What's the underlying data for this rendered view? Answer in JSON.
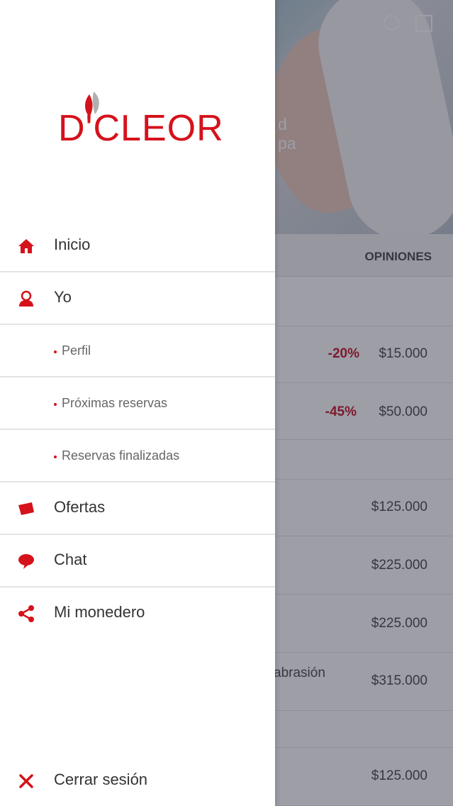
{
  "brand": {
    "logo_text": "D'CLEOR",
    "accent_color": "#d5121b"
  },
  "menu": {
    "items": [
      {
        "label": "Inicio",
        "icon": "home-icon"
      },
      {
        "label": "Yo",
        "icon": "user-icon"
      },
      {
        "label": "Perfil"
      },
      {
        "label": "Próximas reservas"
      },
      {
        "label": "Reservas finalizadas"
      },
      {
        "label": "Ofertas",
        "icon": "tag-icon"
      },
      {
        "label": "Chat",
        "icon": "chat-bubble-icon"
      },
      {
        "label": "Mi monedero",
        "icon": "share-icon"
      }
    ],
    "logout": {
      "label": "Cerrar sesión",
      "icon": "close-icon"
    }
  },
  "background": {
    "hero_text_line1": "d",
    "hero_text_line2": "pa",
    "tab_label": "OPINIONES",
    "rows": [
      {
        "discount": "-20%",
        "price": "$15.000"
      },
      {
        "discount": "-45%",
        "price": "$50.000"
      },
      {
        "price": "$125.000"
      },
      {
        "price": "$225.000"
      },
      {
        "price": "$225.000"
      },
      {
        "desc": "abrasión",
        "price": "$315.000"
      },
      {
        "price": "$125.000"
      }
    ]
  }
}
